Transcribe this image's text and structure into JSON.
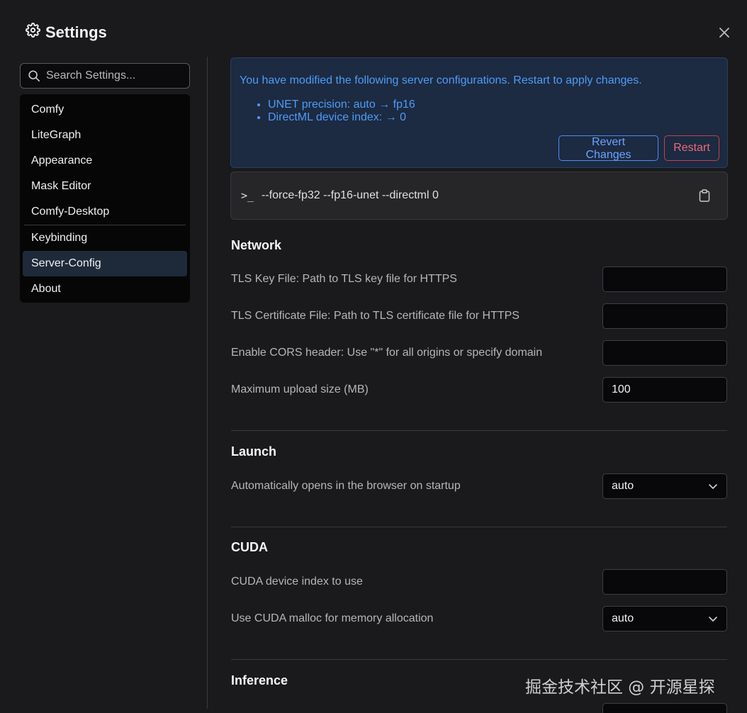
{
  "header": {
    "title": "Settings"
  },
  "search": {
    "placeholder": "Search Settings..."
  },
  "sidebar": {
    "items": [
      {
        "label": "Comfy"
      },
      {
        "label": "LiteGraph"
      },
      {
        "label": "Appearance"
      },
      {
        "label": "Mask Editor"
      },
      {
        "label": "Comfy-Desktop"
      },
      {
        "label": "Keybinding"
      },
      {
        "label": "Server-Config"
      },
      {
        "label": "About"
      }
    ],
    "active": "Server-Config"
  },
  "banner": {
    "message": "You have modified the following server configurations. Restart to apply changes.",
    "changes": [
      "UNET precision: auto → fp16",
      "DirectML device index: → 0"
    ],
    "revert_label": "Revert Changes",
    "restart_label": "Restart"
  },
  "command": {
    "prompt": ">_",
    "text": "--force-fp32 --fp16-unet --directml 0"
  },
  "sections": {
    "network": {
      "title": "Network",
      "tls_key_label": "TLS Key File: Path to TLS key file for HTTPS",
      "tls_key_value": "",
      "tls_cert_label": "TLS Certificate File: Path to TLS certificate file for HTTPS",
      "tls_cert_value": "",
      "cors_label": "Enable CORS header: Use \"*\" for all origins or specify domain",
      "cors_value": "",
      "upload_label": "Maximum upload size (MB)",
      "upload_value": "100"
    },
    "launch": {
      "title": "Launch",
      "auto_open_label": "Automatically opens in the browser on startup",
      "auto_open_value": "auto"
    },
    "cuda": {
      "title": "CUDA",
      "device_label": "CUDA device index to use",
      "device_value": "",
      "malloc_label": "Use CUDA malloc for memory allocation",
      "malloc_value": "auto"
    },
    "inference": {
      "title": "Inference"
    }
  },
  "watermark": "掘金技术社区 @ 开源星探",
  "colors": {
    "background": "#1a1a1c",
    "accent_blue": "#4f9cf5",
    "banner_bg": "#1c2a42",
    "danger": "#f06a74",
    "active_item": "#1e2a3a"
  }
}
